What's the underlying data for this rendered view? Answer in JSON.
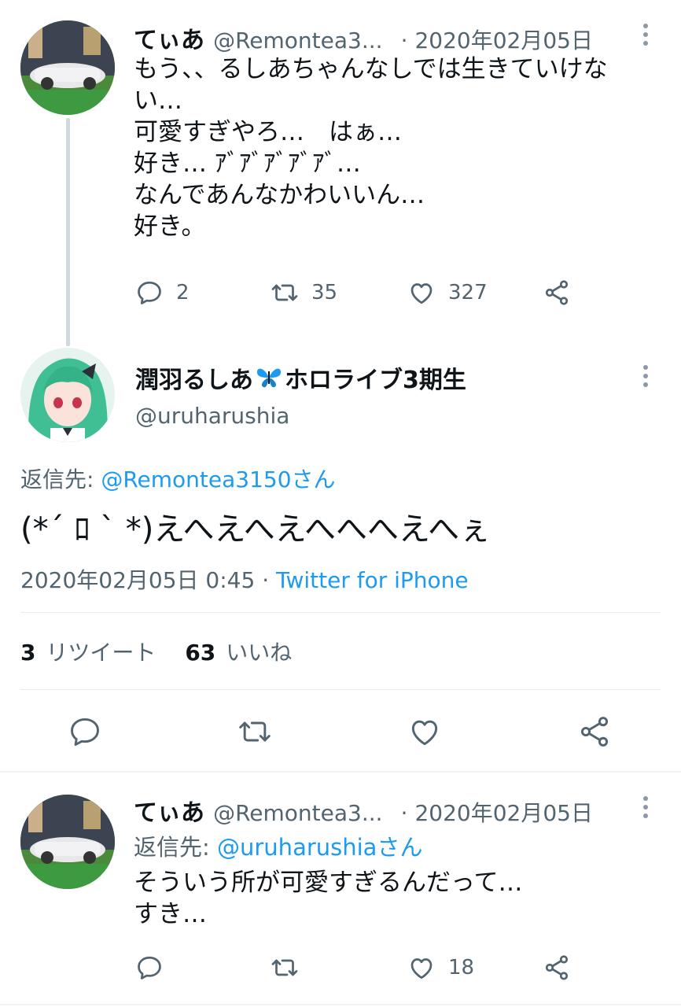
{
  "tweet1": {
    "name": "てぃあ",
    "handle": "@Remontea3...",
    "date": "· 2020年02月05日",
    "text": "もう、、るしあちゃんなしでは生きていけな\nい…\n可愛すぎやろ…　はぁ…\n好き… ｱﾞｱﾞｱﾞｱﾞｱﾞ…\nなんであんなかわいいん…\n好き。",
    "reply_count": "2",
    "retweet_count": "35",
    "like_count": "327"
  },
  "main_tweet": {
    "name": "潤羽るしあ",
    "name_suffix": "ホロライブ3期生",
    "handle": "@uruharushia",
    "reply_prefix": "返信先: ",
    "reply_to": "@Remontea3150さん",
    "text": "(*´ ﾛ ` *)えへえへえへへへえへぇ",
    "timestamp": "2020年02月05日 0:45 · ",
    "source": "Twitter for iPhone",
    "retweets_num": "3",
    "retweets_label": "リツイート",
    "likes_num": "63",
    "likes_label": "いいね"
  },
  "tweet3": {
    "name": "てぃあ",
    "handle": "@Remontea3...",
    "date": "· 2020年02月05日",
    "reply_prefix": "返信先: ",
    "reply_to": "@uruharushiaさん",
    "text": "そういう所が可愛すぎるんだって…\nすき…",
    "like_count": "18"
  },
  "colors": {
    "link": "#1d9bf0",
    "secondary": "#536471",
    "butterfly": "#1d9bf0"
  },
  "icons": [
    "reply-icon",
    "retweet-icon",
    "like-icon",
    "share-icon",
    "more-icon",
    "butterfly-icon"
  ]
}
